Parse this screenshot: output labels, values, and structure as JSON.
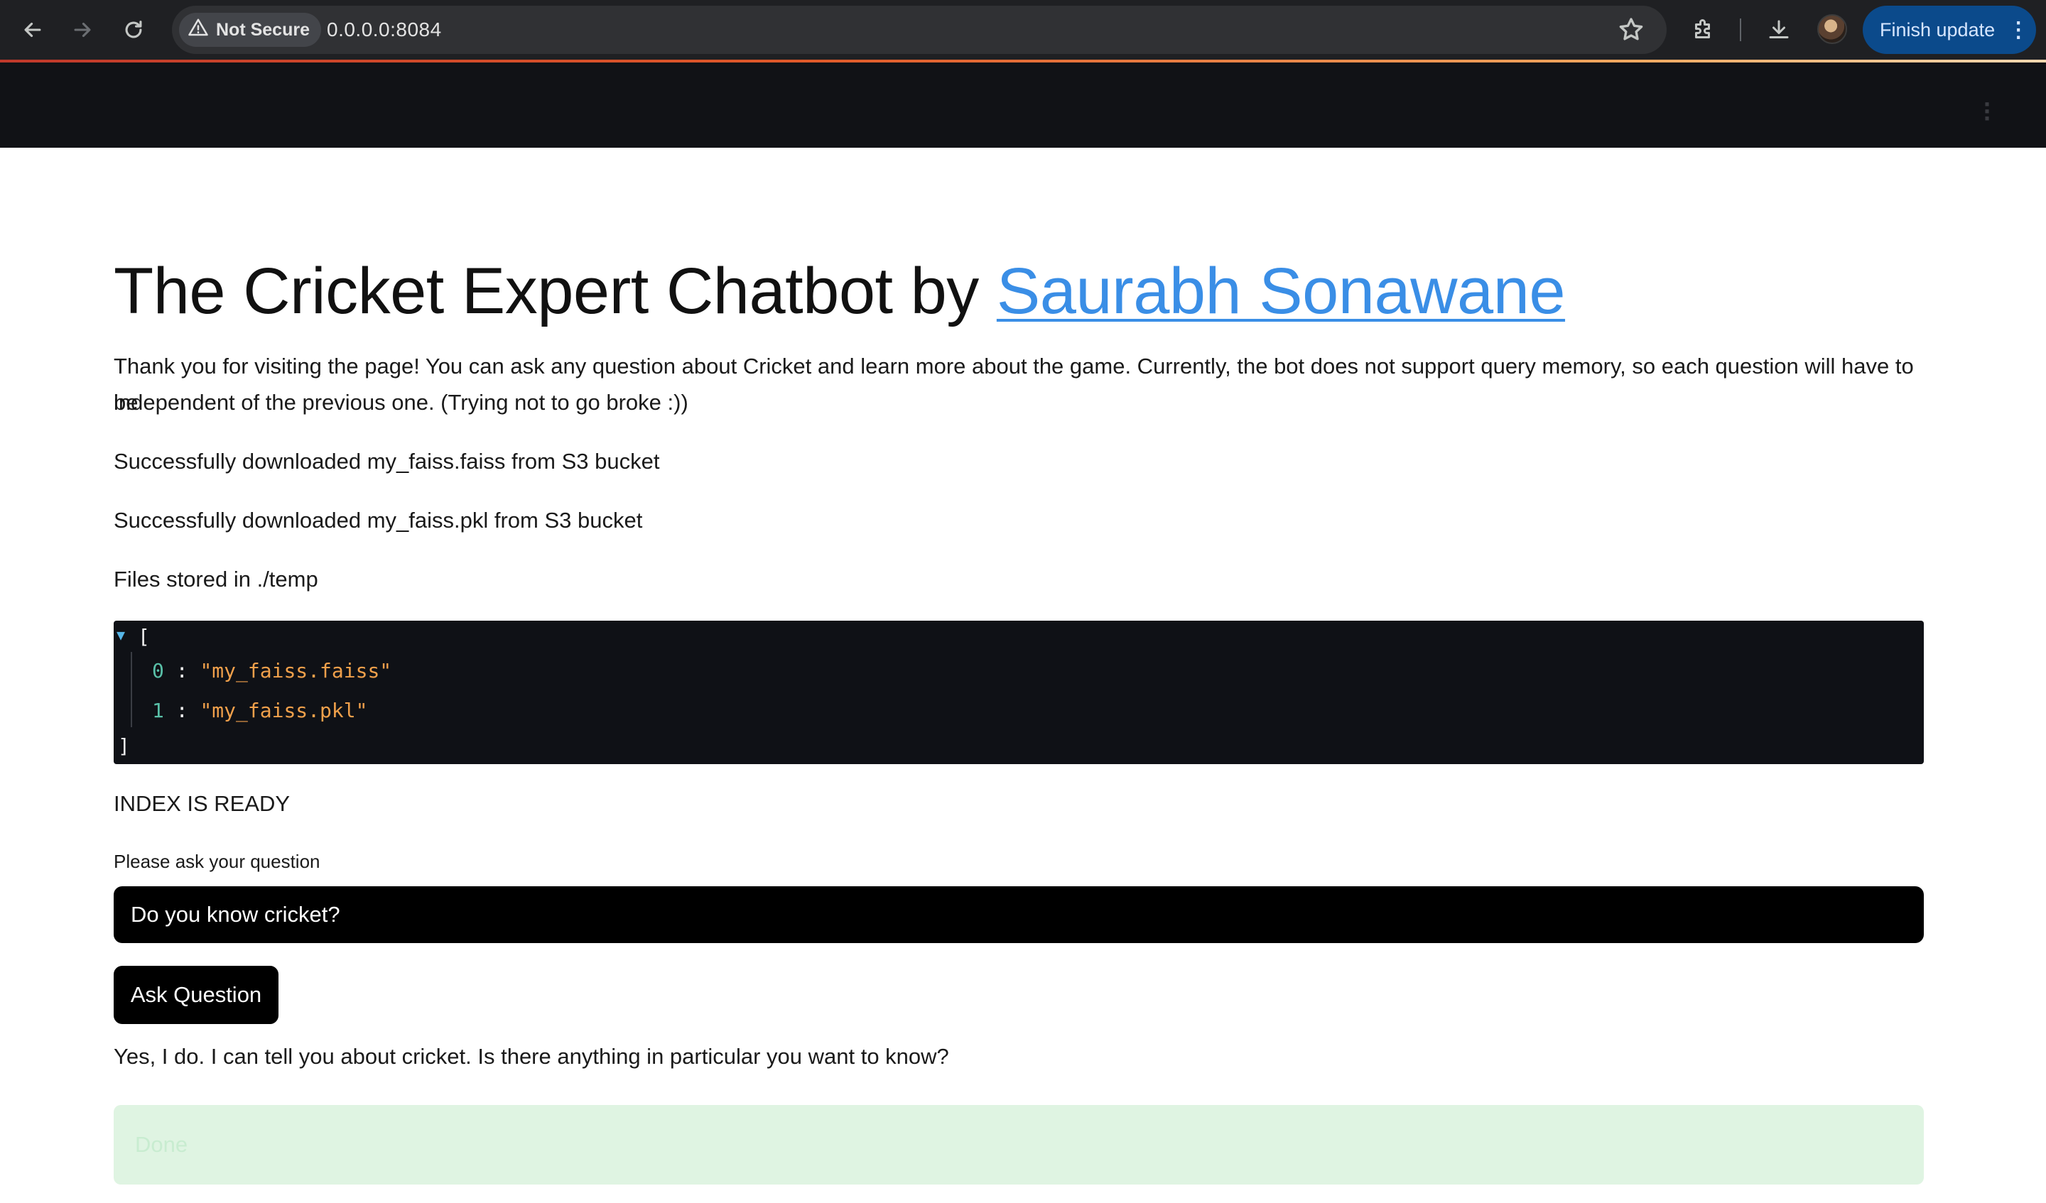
{
  "browser": {
    "security_label": "Not Secure",
    "url": "0.0.0.0:8084",
    "update_label": "Finish update",
    "update_menu": "⋮"
  },
  "app": {
    "title_prefix": "The Cricket Expert Chatbot by ",
    "title_link": "Saurabh Sonawane",
    "intro_line1": "Thank you for visiting the page! You can ask any question about Cricket and learn more about the game. Currently, the bot does not support query memory, so each question will have to be",
    "intro_line2": "independent of the previous one. (Trying not to go broke :))",
    "status_messages": [
      "Successfully downloaded my_faiss.faiss from S3 bucket",
      "Successfully downloaded my_faiss.pkl from S3 bucket",
      "Files stored in ./temp"
    ],
    "json_view": {
      "open_bracket": "[",
      "close_bracket": "]",
      "items": [
        {
          "index": "0",
          "value": "\"my_faiss.faiss\""
        },
        {
          "index": "1",
          "value": "\"my_faiss.pkl\""
        }
      ]
    },
    "index_status": "INDEX IS READY",
    "question_label": "Please ask your question",
    "question_value": "Do you know cricket?",
    "ask_button": "Ask Question",
    "answer": "Yes, I do. I can tell you about cricket. Is there anything in particular you want to know?",
    "success_message": "Done"
  }
}
